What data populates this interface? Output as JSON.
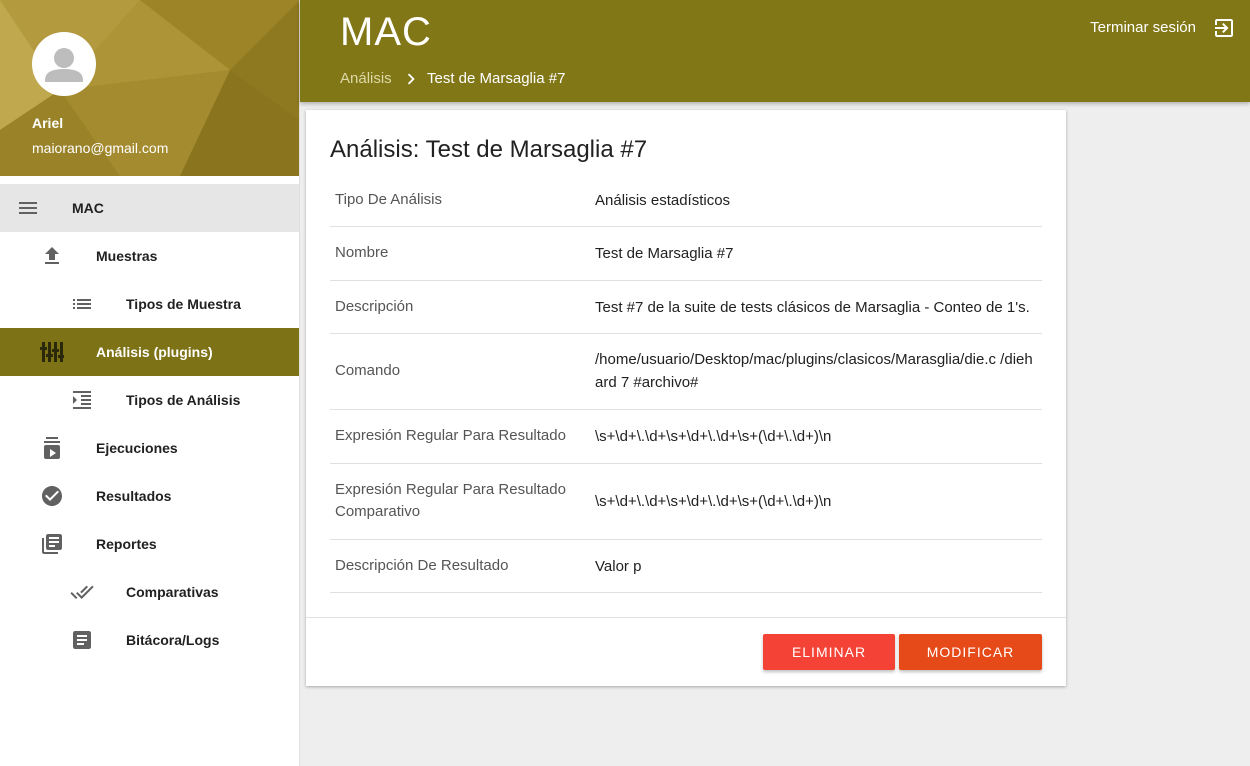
{
  "profile": {
    "name": "Ariel",
    "email": "maiorano@gmail.com"
  },
  "menu": {
    "header_label": "MAC"
  },
  "nav": [
    {
      "label": "Muestras",
      "icon": "upload-icon"
    },
    {
      "label": "Tipos de Muestra",
      "icon": "list-icon"
    },
    {
      "label": "Análisis (plugins)",
      "icon": "tune-sliders-icon",
      "active": true
    },
    {
      "label": "Tipos de Análisis",
      "icon": "indent-list-icon"
    },
    {
      "label": "Ejecuciones",
      "icon": "play-queue-icon"
    },
    {
      "label": "Resultados",
      "icon": "check-circle-icon"
    },
    {
      "label": "Reportes",
      "icon": "library-books-icon"
    },
    {
      "label": "Comparativas",
      "icon": "done-all-icon"
    },
    {
      "label": "Bitácora/Logs",
      "icon": "log-receipt-icon"
    }
  ],
  "header": {
    "title": "MAC",
    "logout_label": "Terminar sesión",
    "breadcrumb": [
      "Análisis",
      "Test de Marsaglia #7"
    ]
  },
  "card": {
    "title": "Análisis: Test de Marsaglia #7",
    "rows": [
      {
        "key": "Tipo De Análisis",
        "value": "Análisis estadísticos"
      },
      {
        "key": "Nombre",
        "value": "Test de Marsaglia #7"
      },
      {
        "key": "Descripción",
        "value": "Test #7 de la suite de tests clásicos de Marsaglia - Conteo de 1's."
      },
      {
        "key": "Comando",
        "value": "/home/usuario/Desktop/mac/plugins/clasicos/Marasglia/die.c /diehard 7 #archivo#"
      },
      {
        "key": "Expresión Regular Para Resultado",
        "value": "\\s+\\d+\\.\\d+\\s+\\d+\\.\\d+\\s+(\\d+\\.\\d+)\\n"
      },
      {
        "key": "Expresión Regular Para Resultado Comparativo",
        "value": "\\s+\\d+\\.\\d+\\s+\\d+\\.\\d+\\s+(\\d+\\.\\d+)\\n"
      },
      {
        "key": "Descripción De Resultado",
        "value": "Valor p"
      }
    ],
    "delete_label": "ELIMINAR",
    "modify_label": "MODIFICAR"
  },
  "colors": {
    "header_bg": "#827717",
    "active_nav_bg": "#7e7216",
    "delete_button": "#f44336",
    "modify_button": "#e64a19"
  }
}
